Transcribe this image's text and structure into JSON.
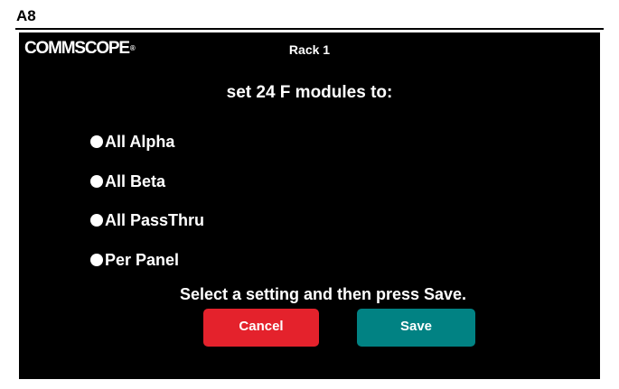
{
  "figure_label": "A8",
  "header": {
    "brand": "COMMSCOPE",
    "brand_mark": "®",
    "title": "Rack 1"
  },
  "prompt": "set 24 F modules to:",
  "options": [
    {
      "label": "All Alpha",
      "selected": false
    },
    {
      "label": "All Beta",
      "selected": false
    },
    {
      "label": "All PassThru",
      "selected": false
    },
    {
      "label": "Per Panel",
      "selected": false
    }
  ],
  "instruction": "Select a setting and then press Save.",
  "buttons": {
    "cancel_label": "Cancel",
    "save_label": "Save"
  },
  "colors": {
    "screen_bg": "#000000",
    "cancel": "#e4222c",
    "save": "#018283",
    "text": "#ffffff"
  }
}
